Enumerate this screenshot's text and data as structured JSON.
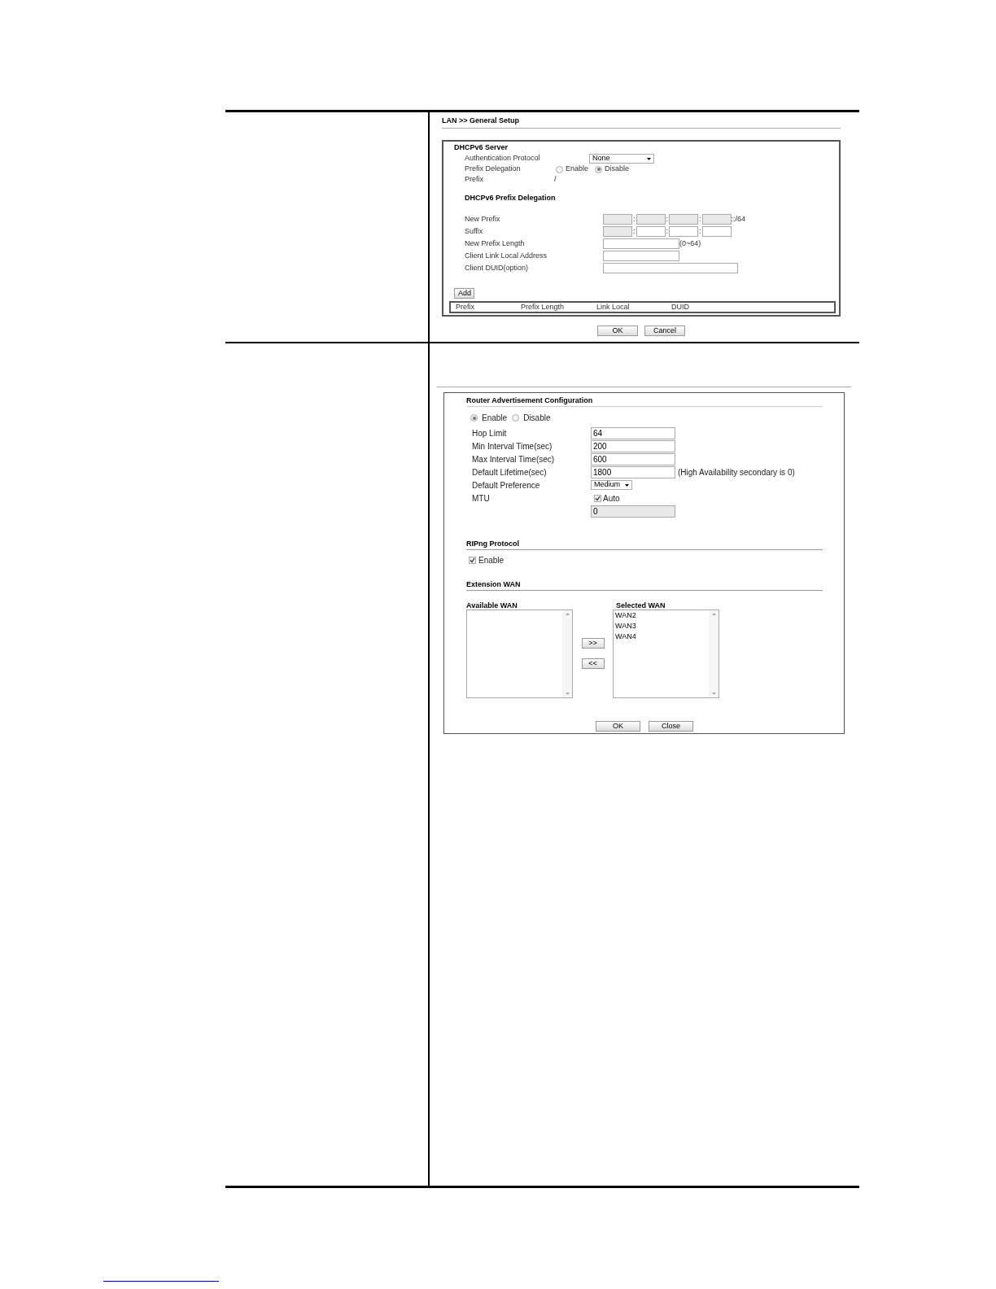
{
  "general_setup": {
    "breadcrumb": "LAN >> General Setup",
    "dhcpv6_server": {
      "title": "DHCPv6 Server",
      "authentication_protocol": {
        "label": "Authentication Protocol",
        "value": "None"
      },
      "prefix_delegation": {
        "label": "Prefix Delegation",
        "options": [
          {
            "label": "Enable",
            "selected": false
          },
          {
            "label": "Disable",
            "selected": true
          }
        ]
      },
      "prefix": {
        "label": "Prefix",
        "value": "/"
      },
      "delegation_title": "DHCPv6 Prefix Delegation",
      "rows": [
        {
          "label": "New Prefix",
          "kind": "segments",
          "segments": [
            {
              "disabled": true
            },
            {
              "disabled": true
            },
            {
              "disabled": true
            },
            {
              "disabled": true
            }
          ],
          "separator": ":",
          "suffix": "::/64"
        },
        {
          "label": "Suffix",
          "kind": "segments",
          "segments": [
            {
              "disabled": true
            },
            {
              "disabled": false
            },
            {
              "disabled": false
            },
            {
              "disabled": false
            }
          ],
          "separator": ":"
        },
        {
          "label": "New Prefix Length",
          "kind": "text",
          "hint": "(0~64)"
        },
        {
          "label": "Client Link Local Address",
          "kind": "text"
        },
        {
          "label": "Client DUID(option)",
          "kind": "long_text"
        }
      ],
      "add_button": "Add",
      "table_columns": [
        "Prefix",
        "Prefix Length",
        "Link Local",
        "DUID"
      ]
    },
    "buttons": [
      "OK",
      "Cancel"
    ]
  },
  "router_advertisement": {
    "title": "Router Advertisement Configuration",
    "mode": [
      {
        "label": "Enable",
        "selected": true
      },
      {
        "label": "Disable",
        "selected": false
      }
    ],
    "fields": [
      {
        "label": "Hop Limit",
        "kind": "text",
        "value": "64"
      },
      {
        "label": "Min Interval Time(sec)",
        "kind": "text",
        "value": "200"
      },
      {
        "label": "Max Interval Time(sec)",
        "kind": "text",
        "value": "600"
      },
      {
        "label": "Default Lifetime(sec)",
        "kind": "text",
        "value": "1800",
        "hint": "(High Availability secondary is 0)"
      },
      {
        "label": "Default Preference",
        "kind": "select",
        "value": "Medium"
      },
      {
        "label": "MTU",
        "kind": "checkbox",
        "checkbox_label": "Auto",
        "checked": true,
        "value": "0",
        "disabled": true
      }
    ],
    "ripng": {
      "title": "RIPng Protocol",
      "enable": {
        "label": "Enable",
        "checked": true
      }
    },
    "extension_wan": {
      "title": "Extension WAN",
      "available": {
        "title": "Available WAN"
      },
      "selected": {
        "title": "Selected WAN",
        "items": [
          "WAN2",
          "WAN3",
          "WAN4"
        ]
      },
      "move_buttons": [
        ">>",
        "<<"
      ]
    },
    "buttons": [
      "OK",
      "Close"
    ]
  }
}
